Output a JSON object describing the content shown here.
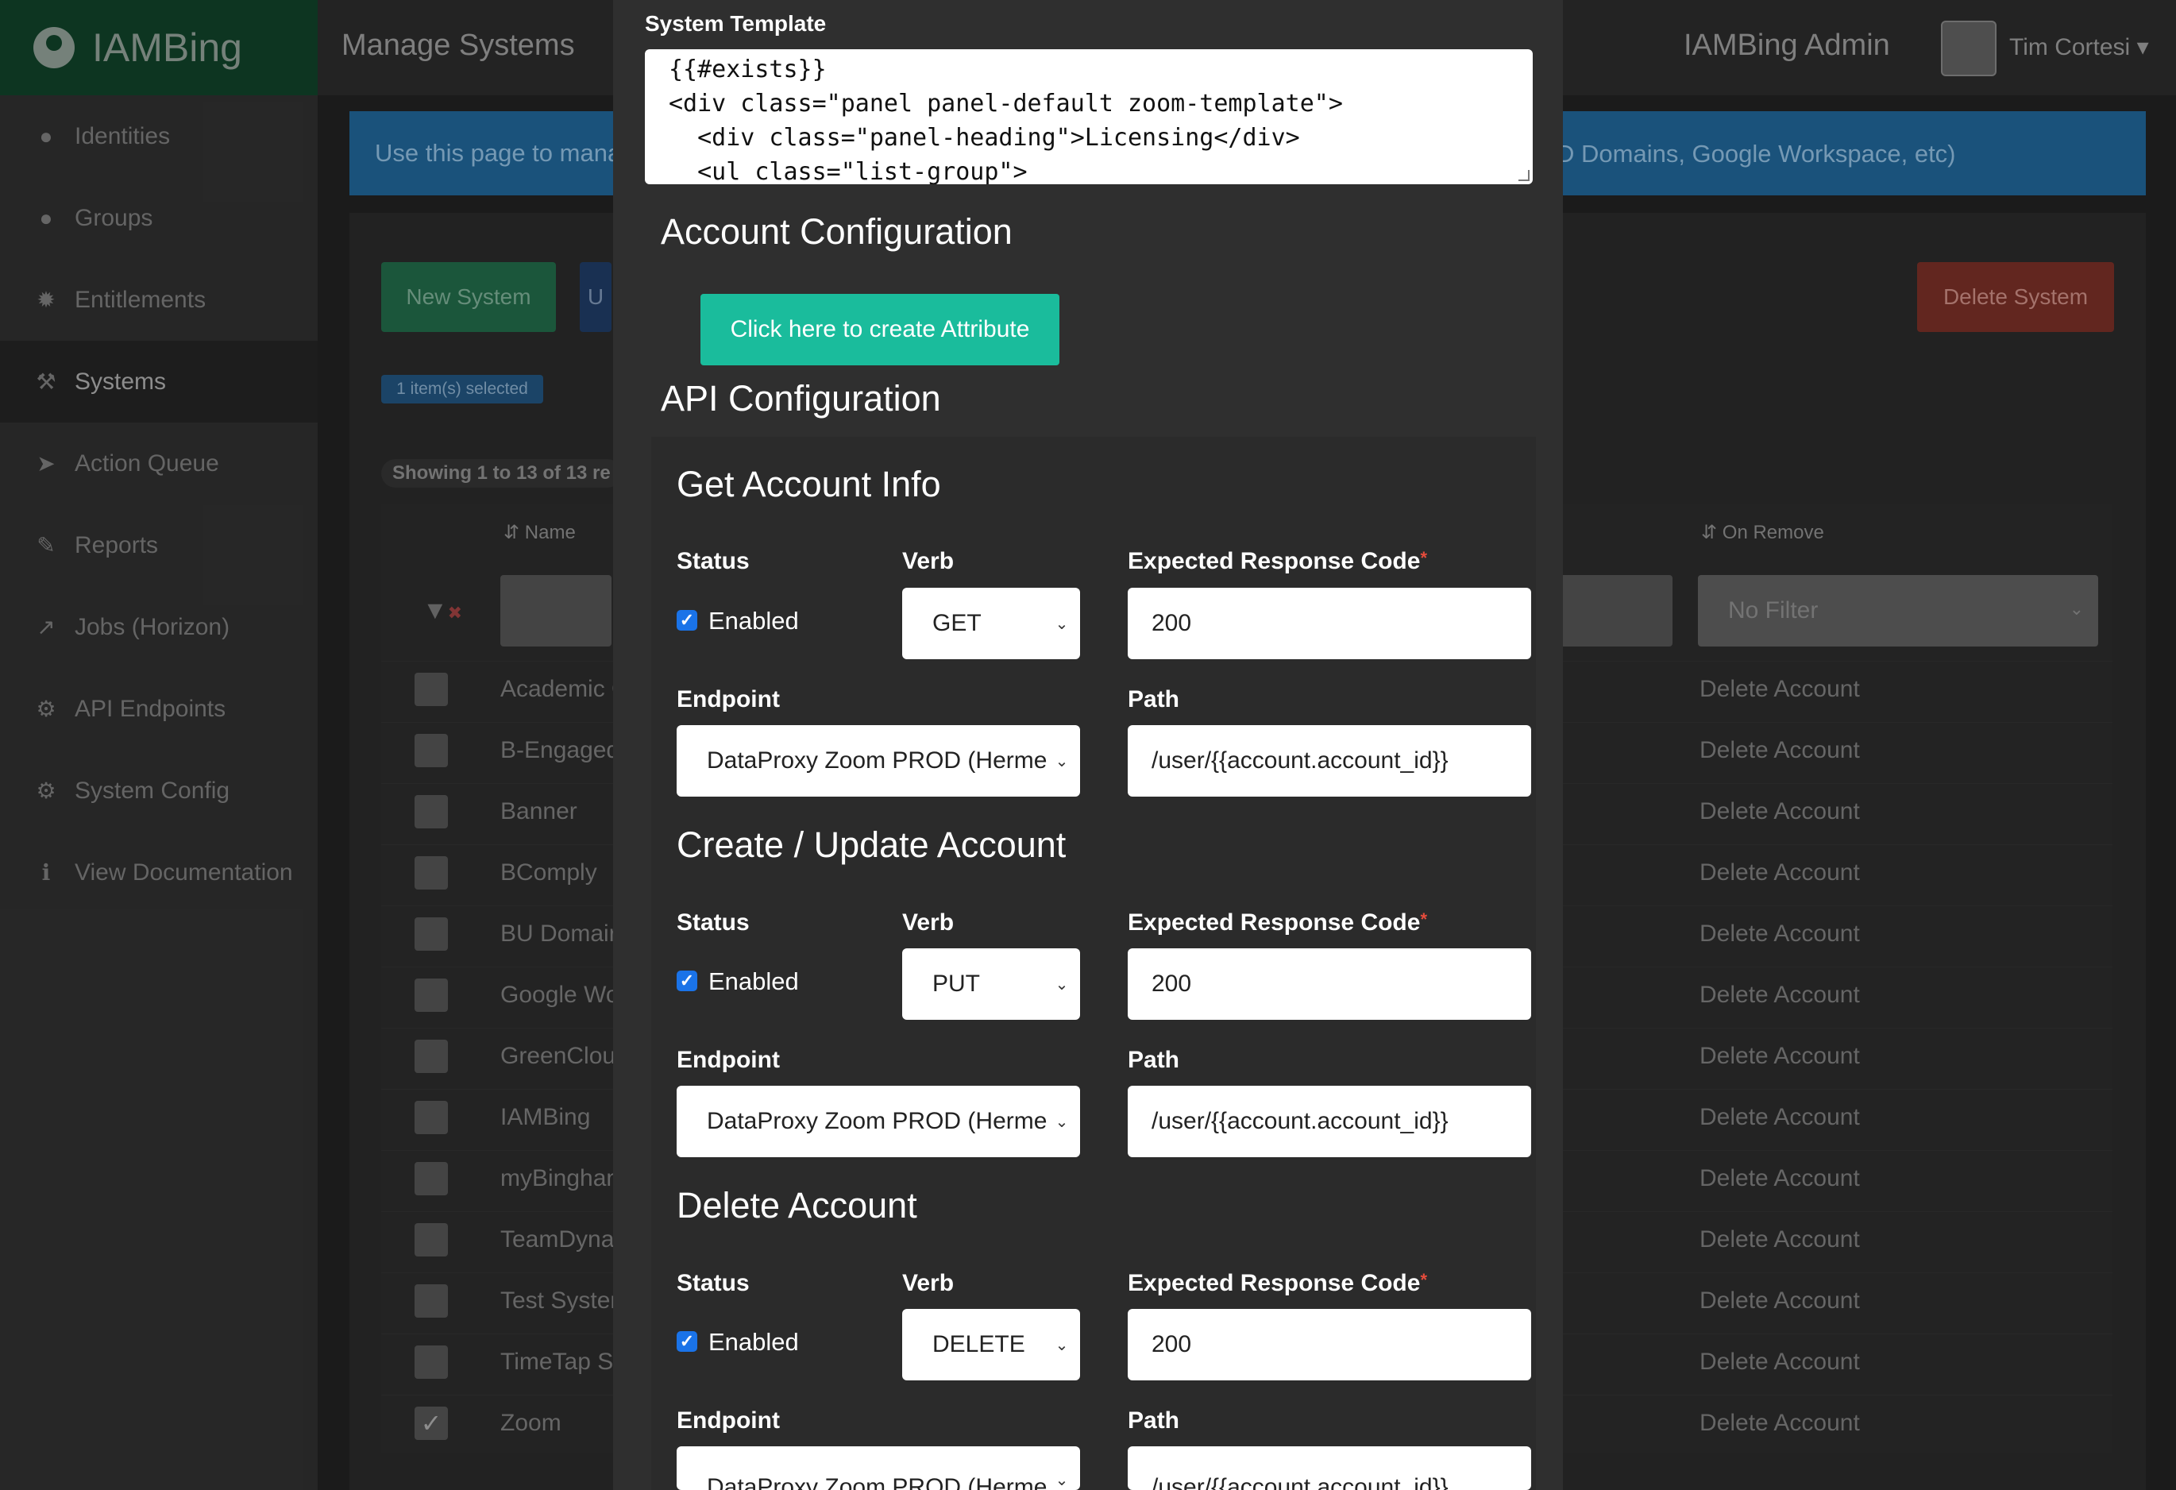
{
  "app": {
    "brand": "IAMBing",
    "page_heading": "Manage Systems",
    "admin_label": "IAMBing Admin",
    "user_name": "Tim Cortesi"
  },
  "sidebar": {
    "items": [
      {
        "label": "Identities",
        "icon": "user-icon"
      },
      {
        "label": "Groups",
        "icon": "users-icon"
      },
      {
        "label": "Entitlements",
        "icon": "badge-icon"
      },
      {
        "label": "Systems",
        "icon": "wrench-icon",
        "active": true
      },
      {
        "label": "Action Queue",
        "icon": "rocket-icon"
      },
      {
        "label": "Reports",
        "icon": "paperclip-icon"
      },
      {
        "label": "Jobs (Horizon)",
        "icon": "line-chart-icon"
      },
      {
        "label": "API Endpoints",
        "icon": "cogs-icon"
      },
      {
        "label": "System Config",
        "icon": "gear-icon"
      },
      {
        "label": "View Documentation",
        "icon": "info-icon"
      }
    ]
  },
  "banner": {
    "text_left": "Use this page to manag",
    "text_right": "D Domains, Google Workspace, etc)"
  },
  "toolbar": {
    "new_system": "New System",
    "second_button": "U",
    "delete_system": "Delete System",
    "selected_badge": "1 item(s) selected",
    "showing": "Showing 1 to 13 of 13 re"
  },
  "table": {
    "headers": {
      "name": "Name",
      "on_remove": "On Remove"
    },
    "remove_filter": "No Filter",
    "rows": [
      {
        "name": "Academic C",
        "action": "Delete Account",
        "checked": false
      },
      {
        "name": "B-Engaged",
        "action": "Delete Account",
        "checked": false
      },
      {
        "name": "Banner",
        "action": "Delete Account",
        "checked": false
      },
      {
        "name": "BComply",
        "action": "Delete Account",
        "checked": false
      },
      {
        "name": "BU Domair",
        "action": "Delete Account",
        "checked": false
      },
      {
        "name": "Google Wo",
        "action": "Delete Account",
        "checked": false
      },
      {
        "name": "GreenClou",
        "action": "Delete Account",
        "checked": false
      },
      {
        "name": "IAMBing",
        "action": "Delete Account",
        "checked": false
      },
      {
        "name": "myBinghan",
        "action": "Delete Account",
        "checked": false
      },
      {
        "name": "TeamDyna",
        "action": "Delete Account",
        "checked": false
      },
      {
        "name": "Test Syster",
        "action": "Delete Account",
        "checked": false
      },
      {
        "name": "TimeTap St",
        "action": "Delete Account",
        "checked": false
      },
      {
        "name": "Zoom",
        "action": "Delete Account",
        "checked": true
      }
    ]
  },
  "modal": {
    "template_label": "System Template",
    "template_lines": [
      "{{#exists}}",
      "<div class=\"panel panel-default zoom-template\">",
      "  <div class=\"panel-heading\">Licensing</div>",
      "  <ul class=\"list-group\">"
    ],
    "account_config_heading": "Account Configuration",
    "create_attribute_button": "Click here to create Attribute",
    "api_config_heading": "API Configuration",
    "labels": {
      "status": "Status",
      "verb": "Verb",
      "expected_response_code": "Expected Response Code",
      "required_mark": "*",
      "endpoint": "Endpoint",
      "path": "Path",
      "enabled": "Enabled"
    },
    "sections": [
      {
        "title": "Get Account Info",
        "enabled": true,
        "verb": "GET",
        "response_code": "200",
        "endpoint": "DataProxy Zoom PROD (Herme",
        "path": "/user/{{account.account_id}}"
      },
      {
        "title": "Create / Update Account",
        "enabled": true,
        "verb": "PUT",
        "response_code": "200",
        "endpoint": "DataProxy Zoom PROD (Herme",
        "path": "/user/{{account.account_id}}"
      },
      {
        "title": "Delete Account",
        "enabled": true,
        "verb": "DELETE",
        "response_code": "200",
        "endpoint": "DataProxy Zoom PROD (Herme",
        "path": "/user/{{account.account_id}}"
      }
    ]
  },
  "colors": {
    "modal_bg": "#2f2f2f",
    "attribute_button": "#1abc9c",
    "checkbox": "#1a73e8",
    "required": "#e74c3c"
  }
}
